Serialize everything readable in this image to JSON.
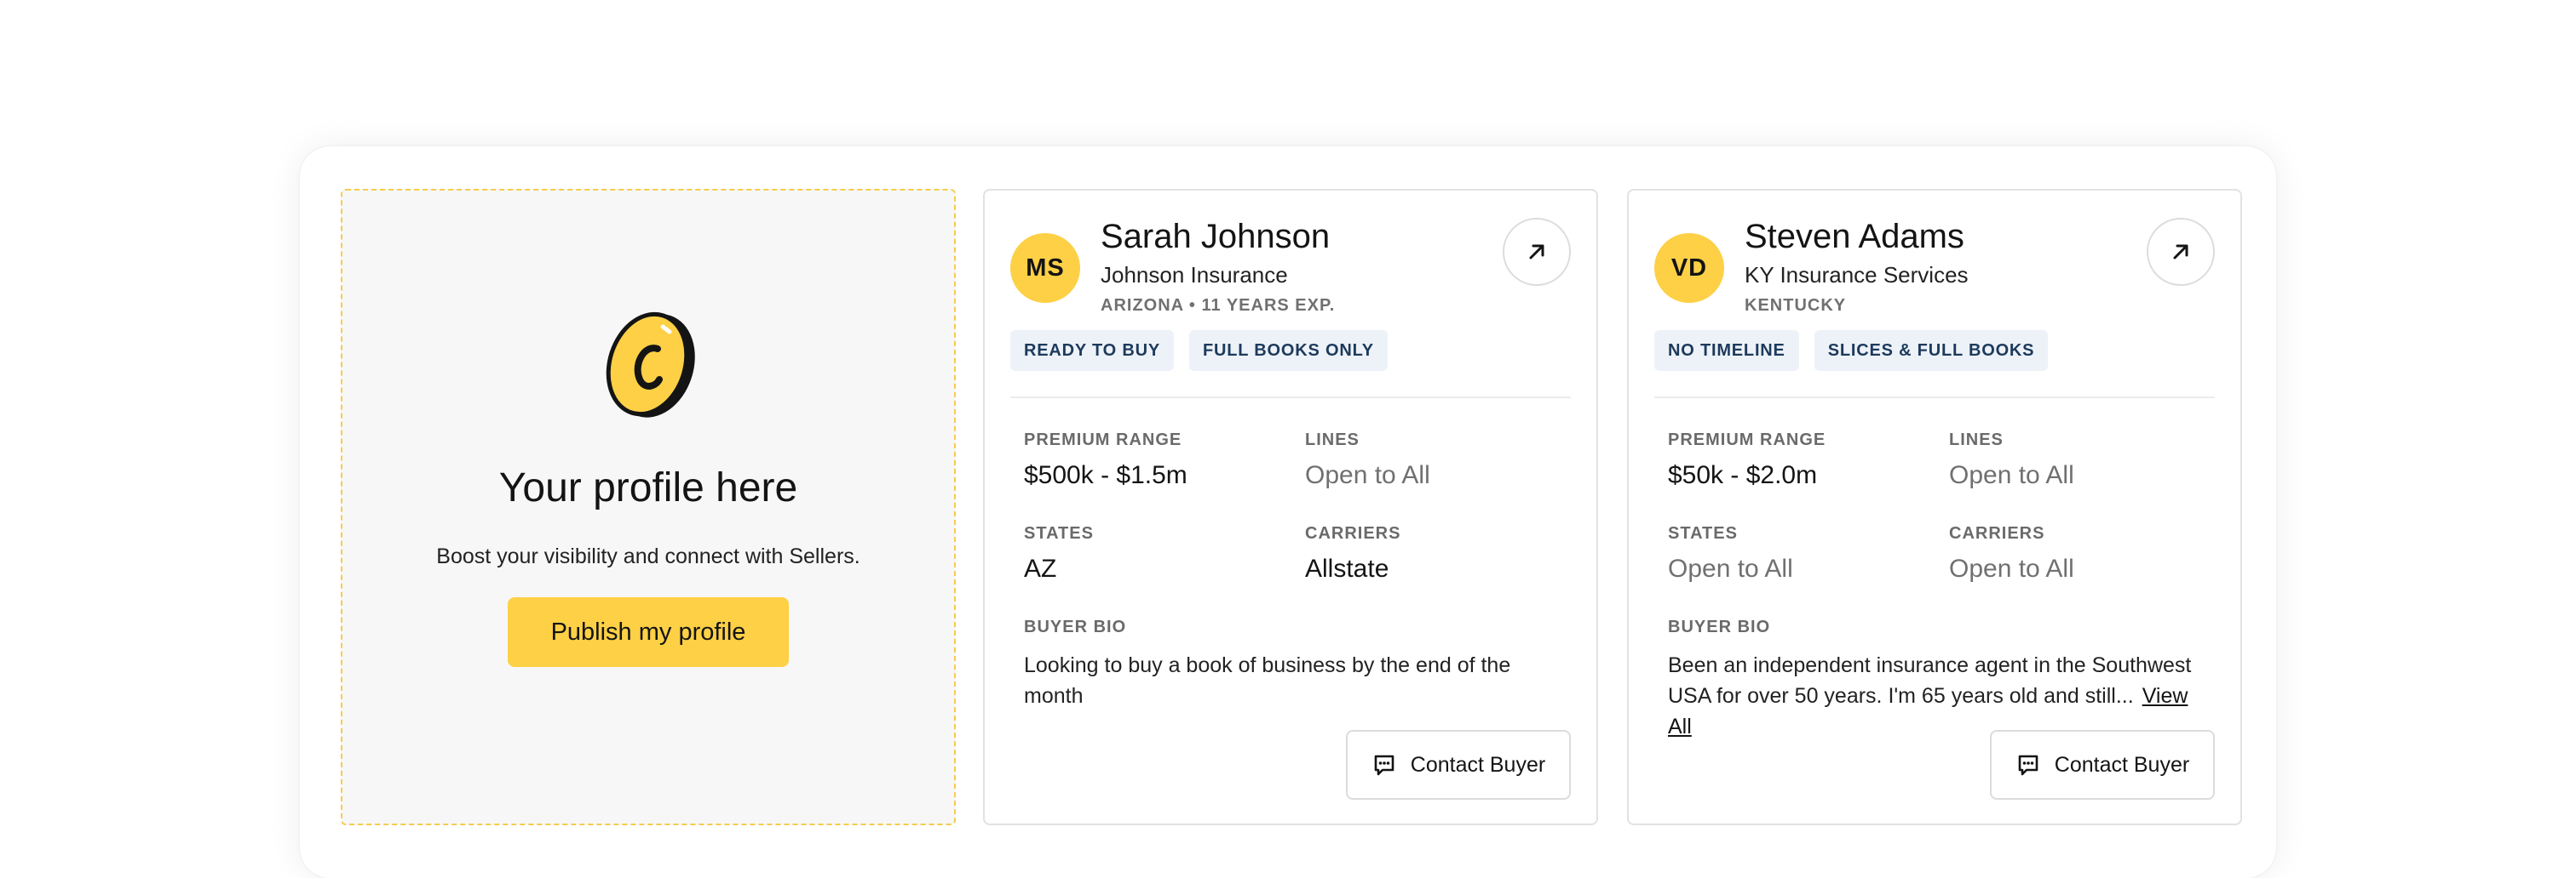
{
  "placeholder": {
    "title": "Your profile here",
    "subtitle": "Boost your visibility and connect with Sellers.",
    "button_label": "Publish my profile",
    "logo_icon": "coin-logo-icon"
  },
  "labels": {
    "premium_range": "PREMIUM RANGE",
    "lines": "LINES",
    "states": "STATES",
    "carriers": "CARRIERS",
    "buyer_bio": "BUYER BIO",
    "contact_button": "Contact Buyer",
    "view_all": "View All"
  },
  "buyers": [
    {
      "initials": "MS",
      "name": "Sarah Johnson",
      "company": "Johnson Insurance",
      "meta": "ARIZONA • 11 YEARS EXP.",
      "tags": [
        "READY TO BUY",
        "FULL BOOKS ONLY"
      ],
      "premium_range": "$500k - $1.5m",
      "lines": "Open to All",
      "states": "AZ",
      "carriers": "Allstate",
      "bio": "Looking to buy a book of business by the end of the month"
    },
    {
      "initials": "VD",
      "name": "Steven Adams",
      "company": "KY Insurance Services",
      "meta": "KENTUCKY",
      "tags": [
        "NO TIMELINE",
        "SLICES & FULL BOOKS"
      ],
      "premium_range": "$50k - $2.0m",
      "lines": "Open to All",
      "states": "Open to All",
      "carriers": "Open to All",
      "bio": "Been an independent insurance agent in the Southwest USA for over 50 years. I'm 65 years old and still..."
    }
  ],
  "colors": {
    "accent": "#fdd046",
    "tag_bg": "#edf2f8",
    "tag_text": "#1d3a5c",
    "placeholder_border": "#f5cc4b"
  }
}
